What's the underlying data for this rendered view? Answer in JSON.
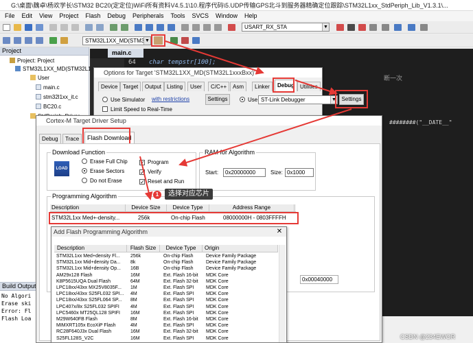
{
  "window": {
    "title": "G:\\桌面\\魏卓\\杨欢学长\\STM32 BC20(定定位)WiFi所有资料V4.5.1\\10.程序代码\\5.UDP传输GPS北斗到服务器精确定位跟踪\\STM32L1xx_StdPeriph_Lib_V1.3.1\\..."
  },
  "menu": [
    "File",
    "Edit",
    "View",
    "Project",
    "Flash",
    "Debug",
    "Peripherals",
    "Tools",
    "SVCS",
    "Window",
    "Help"
  ],
  "toolbar": {
    "search_combo": "USART_RX_STA",
    "target_combo": "STM32L1XX_MD(STM32L1"
  },
  "project_panel": {
    "title": "Project",
    "items": [
      {
        "label": "Project: Project",
        "level": 0,
        "icon": "project-icon"
      },
      {
        "label": "STM32L1XX_MD(STM32L1...",
        "level": 1,
        "icon": "target-icon"
      },
      {
        "label": "User",
        "level": 2,
        "icon": "folder-icon"
      },
      {
        "label": "main.c",
        "level": 3,
        "icon": "file-icon"
      },
      {
        "label": "stm32l1xx_it.c",
        "level": 3,
        "icon": "file-icon"
      },
      {
        "label": "BC20.c",
        "level": 3,
        "icon": "file-icon"
      },
      {
        "label": "StdPeriph_Driver",
        "level": 2,
        "icon": "folder-icon"
      }
    ]
  },
  "editor": {
    "tab": "main.c",
    "line_number": "64",
    "code_line": "char tempstr[100];",
    "comment_fragment": "断一次",
    "date_fragment": "########(\"__DATE__\""
  },
  "options_dialog": {
    "title": "Options for Target 'STM32L1XX_MD(STM32L1xxxBxx)'",
    "tabs": [
      "Device",
      "Target",
      "Output",
      "Listing",
      "User",
      "C/C++",
      "Asm",
      "Linker",
      "Debug",
      "Utilities"
    ],
    "active_tab": "Debug",
    "use_simulator": "Use Simulator",
    "with_restrictions": "with restrictions",
    "settings_label": "Settings",
    "limit_speed": "Limit Speed to Real-Time",
    "use_label": "Use:",
    "debugger": "ST-Link Debugger",
    "settings_right": "Settings"
  },
  "cortex_dialog": {
    "title": "Cortex-M Target Driver Setup",
    "tabs": [
      "Debug",
      "Trace",
      "Flash Download"
    ],
    "active_tab": "Flash Download",
    "download_function": {
      "label": "Download Function",
      "load_icon_text": "LOAD",
      "options": [
        "Erase Full Chip",
        "Erase Sectors",
        "Do not Erase"
      ],
      "selected": "Erase Sectors",
      "checks": [
        {
          "label": "Program",
          "checked": true
        },
        {
          "label": "Verify",
          "checked": true
        },
        {
          "label": "Reset and Run",
          "checked": true
        }
      ]
    },
    "ram": {
      "label": "RAM for Algorithm",
      "start_label": "Start:",
      "start_value": "0x20000000",
      "size_label": "Size:",
      "size_value": "0x1000"
    },
    "programming": {
      "label": "Programming Algorithm",
      "columns": [
        "Description",
        "Device Size",
        "Device Type",
        "Address Range"
      ],
      "selected_row": {
        "description": "STM32L1xx Med+-density...",
        "size": "256k",
        "type": "On-chip Flash",
        "range": "08000000H - 0803FFFFH"
      },
      "size_partial": "0x00040000"
    },
    "callout": {
      "number": "1",
      "text": "选择对应芯片"
    }
  },
  "add_flash_dialog": {
    "title": "Add Flash Programming Algorithm",
    "columns": [
      "Description",
      "Flash Size",
      "Device Type",
      "Origin"
    ],
    "rows": [
      [
        "STM32L1xx Med+density Fl...",
        "256k",
        "On-chip Flash",
        "Device Family Package"
      ],
      [
        "STM32L1xx Mid+density Da...",
        "8k",
        "On-chip Flash",
        "Device Family Package"
      ],
      [
        "STM32L1xx Mid+density Op...",
        "16B",
        "On-chip Flash",
        "Device Family Package"
      ],
      [
        "AM29x128 Flash",
        "16M",
        "Ext. Flash 16-bit",
        "MDK Core"
      ],
      [
        "K8P5615UQA Dual Flash",
        "64M",
        "Ext. Flash 32-bit",
        "MDK Core"
      ],
      [
        "LPC18xx/43xx MX25V8035F...",
        "1M",
        "Ext. Flash SPI",
        "MDK Core"
      ],
      [
        "LPC18xx/43xx S25FL032 SPI...",
        "4M",
        "Ext. Flash SPI",
        "MDK Core"
      ],
      [
        "LPC18xx/43xx S25FL064 SP...",
        "8M",
        "Ext. Flash SPI",
        "MDK Core"
      ],
      [
        "LPC407x/8x S25FL032 SPIFI",
        "4M",
        "Ext. Flash SPI",
        "MDK Core"
      ],
      [
        "LPC5460x MT25QL128 SPIFI",
        "16M",
        "Ext. Flash SPI",
        "MDK Core"
      ],
      [
        "M29W640FB Flash",
        "8M",
        "Ext. Flash 16-bit",
        "MDK Core"
      ],
      [
        "MIMXRT105x EcoXiP Flash",
        "4M",
        "Ext. Flash SPI",
        "MDK Core"
      ],
      [
        "RC28F640J3x Dual Flash",
        "16M",
        "Ext. Flash 32-bit",
        "MDK Core"
      ],
      [
        "S25FL128S_V2C",
        "16M",
        "Ext. Flash SPI",
        "MDK Core"
      ]
    ]
  },
  "build_output": {
    "title": "Build Output",
    "lines": [
      "No Algori",
      "Erase ski",
      "Error: Fl",
      "Flash Loa"
    ]
  },
  "watermark": "CSDN @234EWOR",
  "colors": {
    "highlight": "#e53935",
    "editor_bg": "#1e1e1e",
    "dialog_bg": "#f0f0f0"
  }
}
